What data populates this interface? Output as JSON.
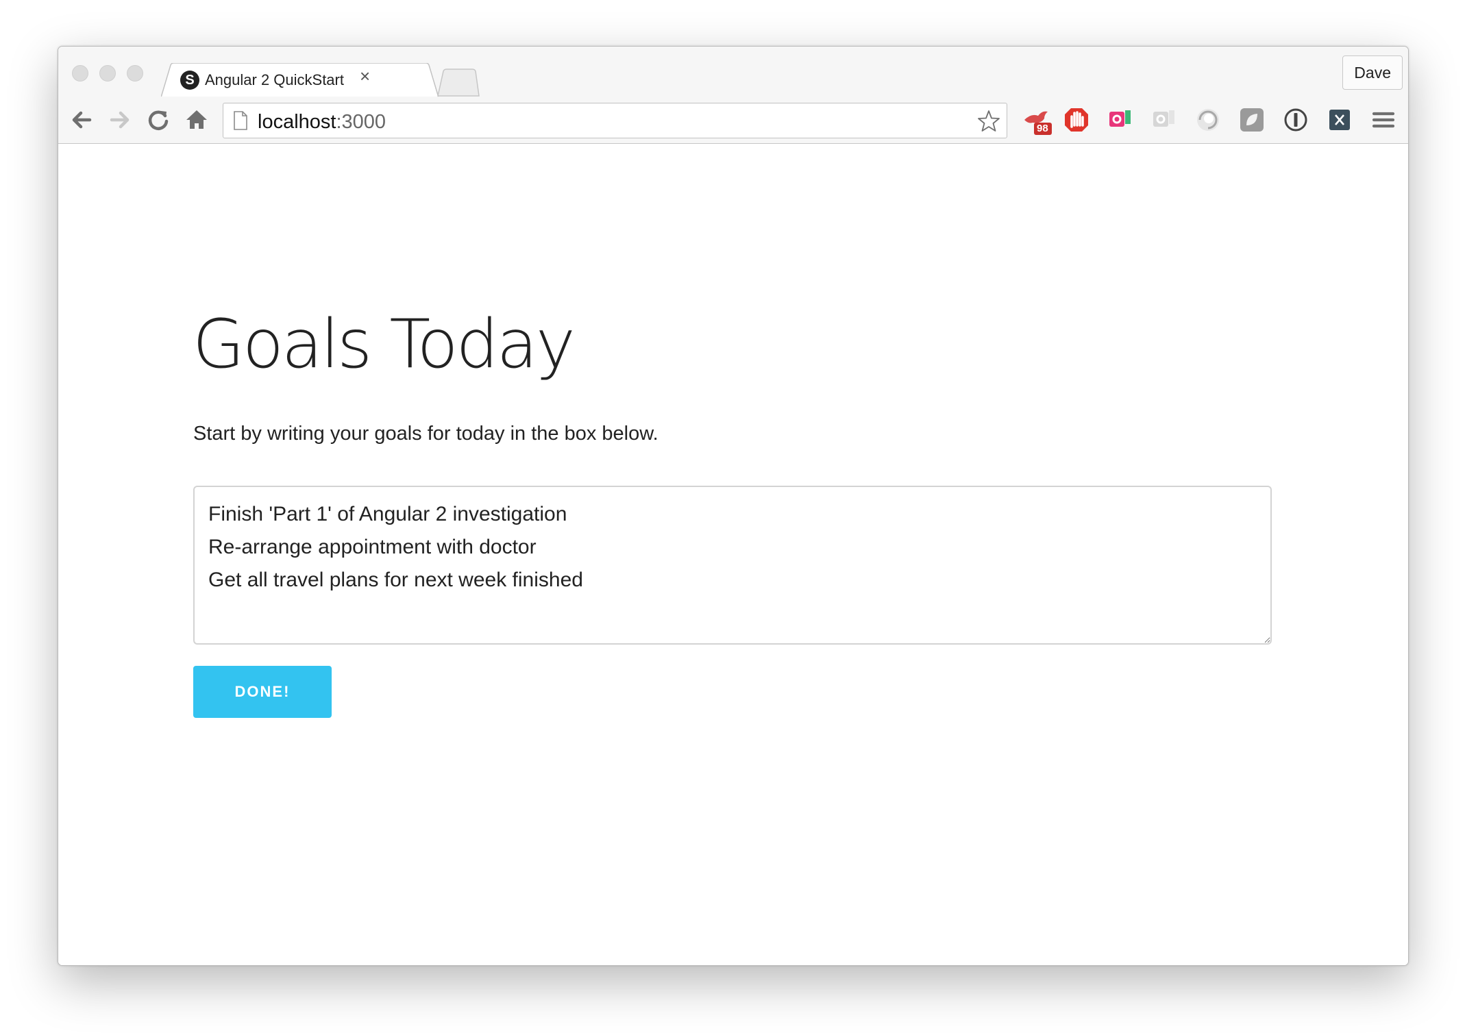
{
  "browser": {
    "tab": {
      "favicon_letter": "S",
      "title": "Angular 2 QuickStart",
      "close_glyph": "×"
    },
    "profile_name": "Dave",
    "address": {
      "host": "localhost",
      "port": ":3000"
    },
    "extensions": [
      {
        "name": "bird-icon",
        "badge": "98"
      },
      {
        "name": "adblock-hand-icon"
      },
      {
        "name": "pink-chat-icon"
      },
      {
        "name": "grey-chat-icon"
      },
      {
        "name": "swirl-icon"
      },
      {
        "name": "gray-square-icon"
      },
      {
        "name": "info-circle-icon"
      },
      {
        "name": "x-square-icon"
      }
    ]
  },
  "page": {
    "heading": "Goals Today",
    "intro": "Start by writing your goals for today in the box below.",
    "goals_text": "Finish 'Part 1' of Angular 2 investigation\nRe-arrange appointment with doctor\nGet all travel plans for next week finished",
    "done_label": "DONE!"
  },
  "colors": {
    "accent": "#33c3f0",
    "text": "#222222",
    "border": "#d3d3d3"
  }
}
